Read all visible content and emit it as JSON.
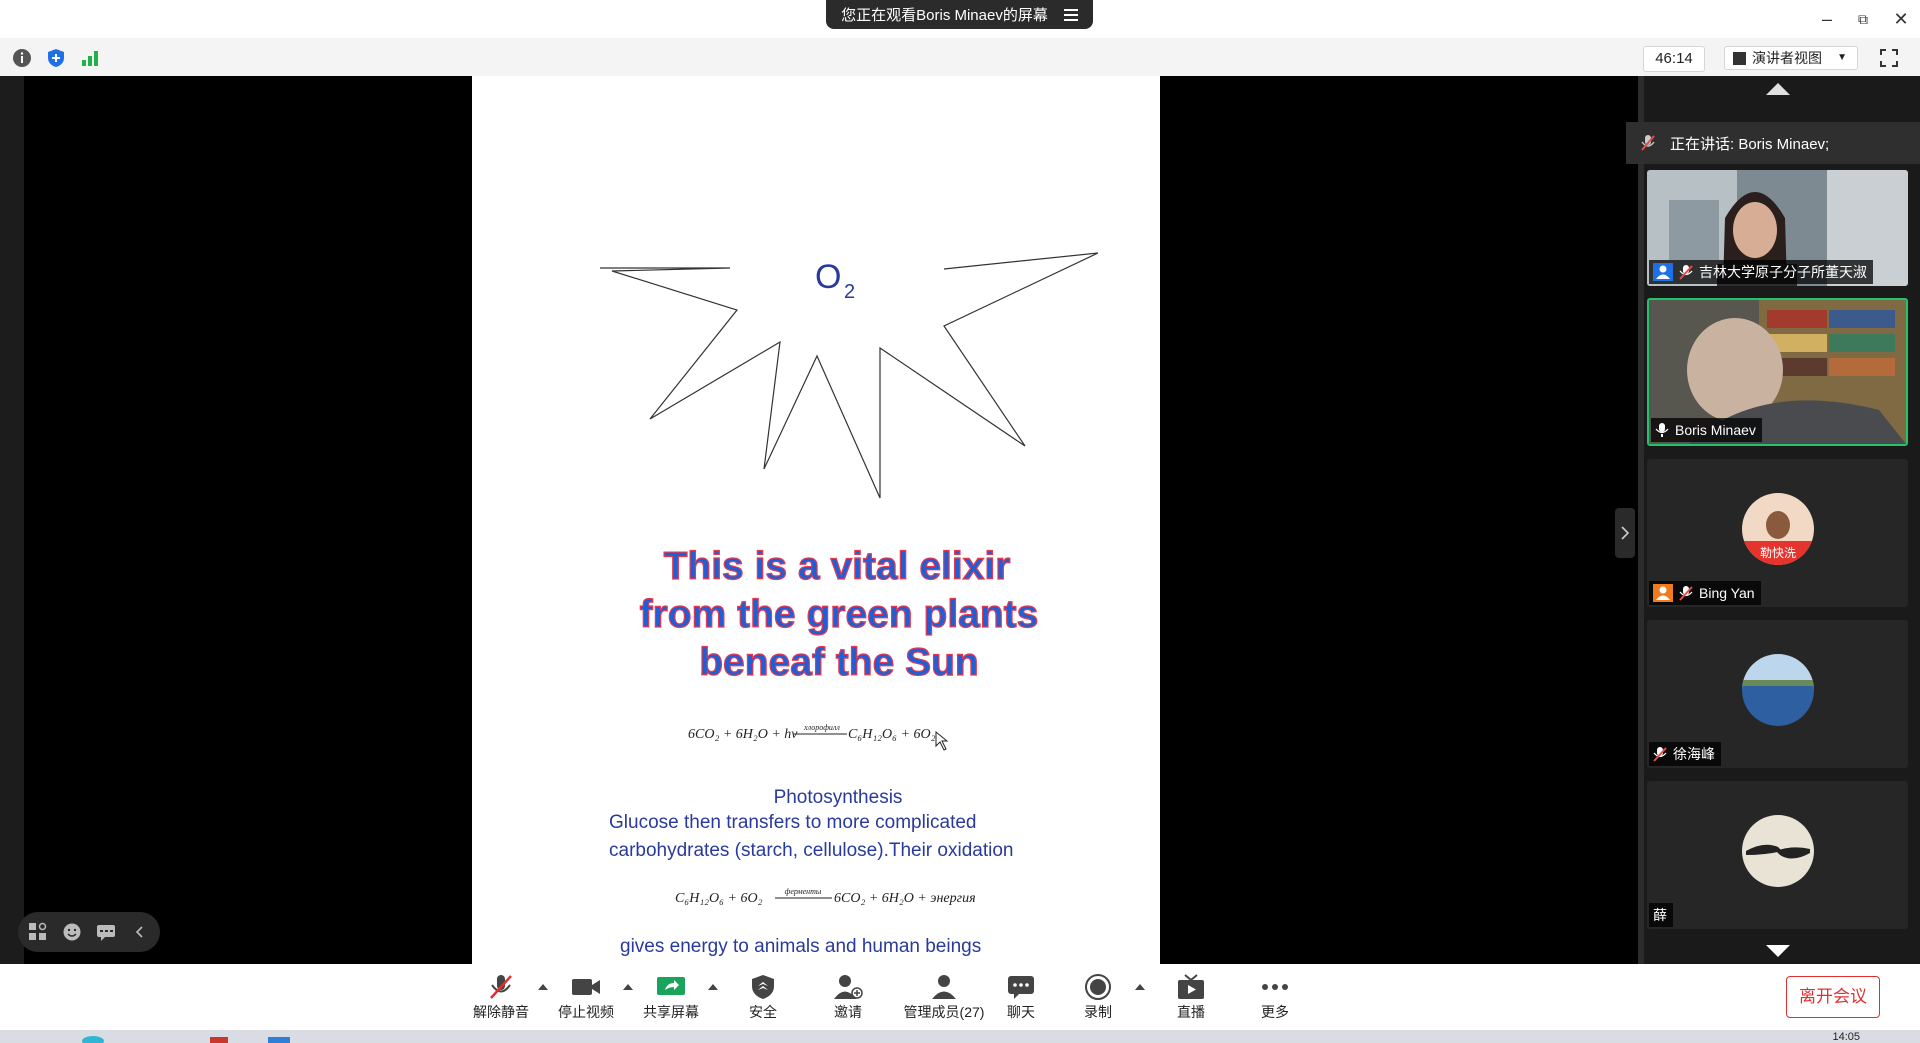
{
  "window": {
    "share_banner": "您正在观看Boris Minaev的屏幕"
  },
  "toolbar": {
    "timer": "46:14",
    "view_mode": "演讲者视图"
  },
  "slide": {
    "molecule": "O",
    "molecule_sub": "2",
    "headline_lines": [
      "This is a vital elixir",
      "from the green plants",
      "beneaf the Sun"
    ],
    "equation1_left": "6CO₂ + 6H₂O + hν",
    "equation1_over": "хлорофилл",
    "equation1_right": "C₆H₁₂O₆ + 6O₂",
    "caption_title": "Photosynthesis",
    "caption_line1": "Glucose then transfers to more complicated",
    "caption_line2": "carbohydrates (starch, cellulose).Their oxidation",
    "equation2_left": "C₆H₁₂O₆ + 6O₂",
    "equation2_over": "ферменты",
    "equation2_right": "6CO₂ + 6H₂O + энергия",
    "footer": "gives energy to animals and human beings"
  },
  "panel": {
    "speaking": "正在讲话: Boris Minaev;",
    "participants": [
      {
        "name": "吉林大学原子分子所董天淑",
        "muted": true
      },
      {
        "name": "Boris Minaev",
        "muted": false
      },
      {
        "name": "Bing Yan",
        "muted": true,
        "avatar_text": "勒快洗"
      },
      {
        "name": "徐海峰",
        "muted": true
      },
      {
        "name": "薛",
        "muted": false
      }
    ]
  },
  "bottom": {
    "unmute": "解除静音",
    "stop_video": "停止视频",
    "share": "共享屏幕",
    "security": "安全",
    "invite": "邀请",
    "participants": "管理成员(27)",
    "chat": "聊天",
    "record": "录制",
    "live": "直播",
    "more": "更多",
    "leave": "离开会议"
  },
  "taskbar": {
    "clock": "14:05"
  },
  "colors": {
    "accent_green": "#24c26a",
    "leave_red": "#e02f2f",
    "headline_blue": "#1d5fd6",
    "caption_blue": "#2a3a9c"
  }
}
